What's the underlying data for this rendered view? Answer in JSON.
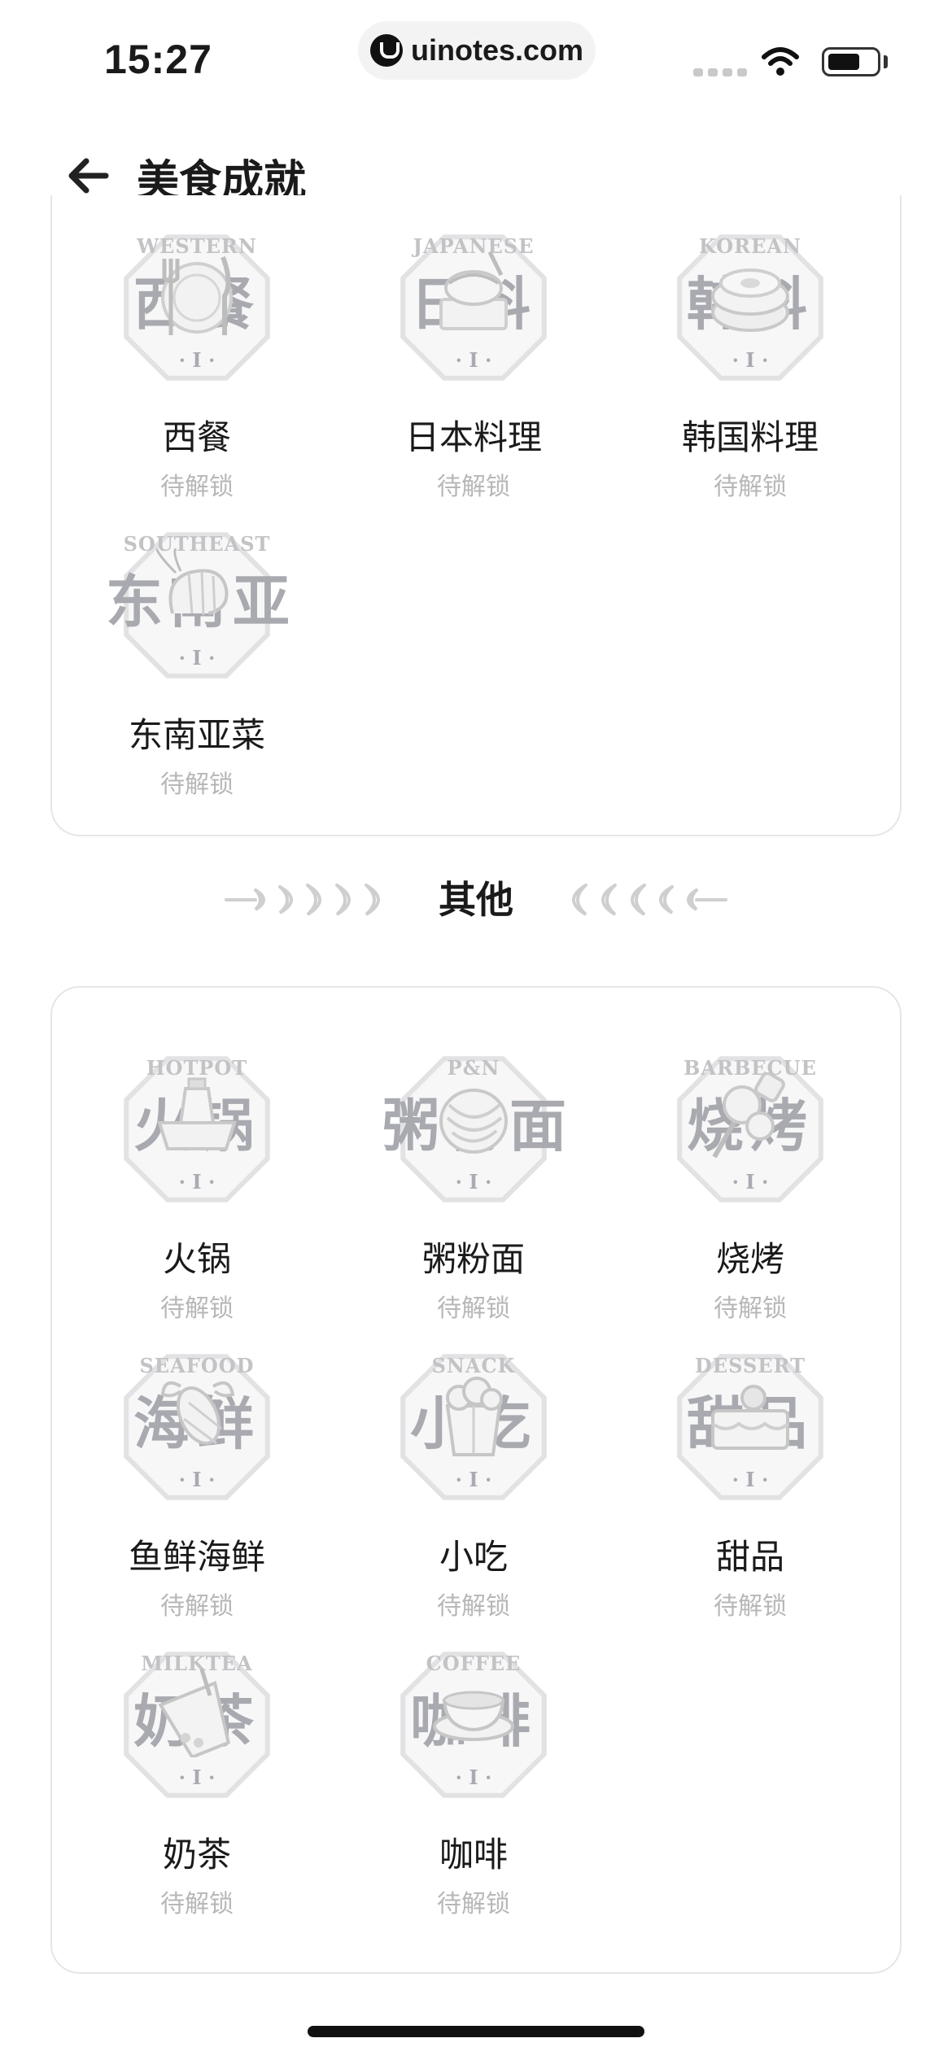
{
  "status_bar": {
    "time": "15:27",
    "url": "uinotes.com"
  },
  "header": {
    "title": "美食成就"
  },
  "section_other": {
    "title": "其他"
  },
  "top_items": [
    {
      "name": "西餐",
      "status": "待解锁",
      "badge_en": "WESTERN",
      "badge_cn": "西餐",
      "level": "· I ·",
      "icon": "plate-fork-knife-icon"
    },
    {
      "name": "日本料理",
      "status": "待解锁",
      "badge_en": "JAPANESE",
      "badge_cn": "日料",
      "level": "· I ·",
      "icon": "sushi-icon"
    },
    {
      "name": "韩国料理",
      "status": "待解锁",
      "badge_en": "KOREAN",
      "badge_cn": "韩料",
      "level": "· I ·",
      "icon": "bibimbap-bowl-icon"
    },
    {
      "name": "东南亚菜",
      "status": "待解锁",
      "badge_en": "SOUTHEAST",
      "badge_cn": "东南亚",
      "level": "· I ·",
      "icon": "shrimp-icon"
    }
  ],
  "other_items": [
    {
      "name": "火锅",
      "status": "待解锁",
      "badge_en": "HOTPOT",
      "badge_cn": "火锅",
      "level": "· I ·",
      "icon": "hotpot-icon"
    },
    {
      "name": "粥粉面",
      "status": "待解锁",
      "badge_en": "P&N",
      "badge_cn": "粥粉面",
      "level": "· I ·",
      "icon": "noodles-icon"
    },
    {
      "name": "烧烤",
      "status": "待解锁",
      "badge_en": "BARBECUE",
      "badge_cn": "烧烤",
      "level": "· I ·",
      "icon": "skewer-icon"
    },
    {
      "name": "鱼鲜海鲜",
      "status": "待解锁",
      "badge_en": "SEAFOOD",
      "badge_cn": "海鲜",
      "level": "· I ·",
      "icon": "lobster-icon"
    },
    {
      "name": "小吃",
      "status": "待解锁",
      "badge_en": "SNACK",
      "badge_cn": "小吃",
      "level": "· I ·",
      "icon": "popcorn-box-icon"
    },
    {
      "name": "甜品",
      "status": "待解锁",
      "badge_en": "DESSERT",
      "badge_cn": "甜品",
      "level": "· I ·",
      "icon": "cake-icon"
    },
    {
      "name": "奶茶",
      "status": "待解锁",
      "badge_en": "MILKTEA",
      "badge_cn": "奶茶",
      "level": "· I ·",
      "icon": "bubble-tea-icon"
    },
    {
      "name": "咖啡",
      "status": "待解锁",
      "badge_en": "COFFEE",
      "badge_cn": "咖啡",
      "level": "· I ·",
      "icon": "coffee-cup-icon"
    }
  ]
}
